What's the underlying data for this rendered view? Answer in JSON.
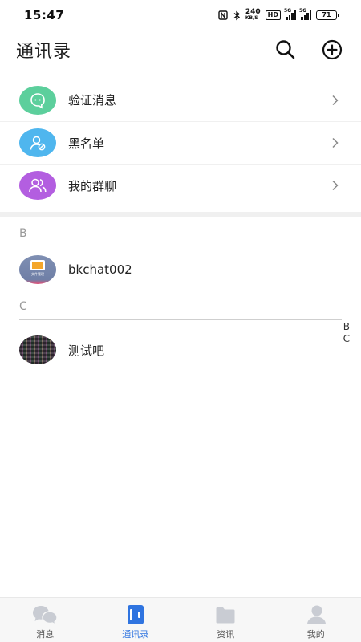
{
  "status": {
    "time": "15:47",
    "net_speed": "240",
    "net_speed_unit": "KB/S",
    "hd_label": "HD",
    "signal1_tag": "5G",
    "signal2_tag": "5G",
    "battery": "71"
  },
  "header": {
    "title": "通讯录",
    "search_icon": "search-icon",
    "add_icon": "plus-circle-icon"
  },
  "menu": {
    "items": [
      {
        "label": "验证消息",
        "icon": "chat-bubble-icon",
        "color": "#5ccf9c"
      },
      {
        "label": "黑名单",
        "icon": "user-blocked-icon",
        "color": "#4fb6ee"
      },
      {
        "label": "我的群聊",
        "icon": "group-icon",
        "color": "#b35ee0"
      }
    ]
  },
  "contacts": {
    "groups": [
      {
        "letter": "B",
        "items": [
          {
            "name": "bkchat002",
            "avatar_caption": "文件管理"
          }
        ]
      },
      {
        "letter": "C",
        "items": [
          {
            "name": "测试吧"
          }
        ]
      }
    ]
  },
  "index_bar": [
    "B",
    "C"
  ],
  "nav": {
    "items": [
      {
        "label": "消息",
        "icon": "chat-icon"
      },
      {
        "label": "通讯录",
        "icon": "contacts-book-icon"
      },
      {
        "label": "资讯",
        "icon": "folder-icon"
      },
      {
        "label": "我的",
        "icon": "user-icon"
      }
    ],
    "active_index": 1,
    "active_color": "#2f74e0",
    "inactive_icon_color": "#c9ccd3"
  }
}
